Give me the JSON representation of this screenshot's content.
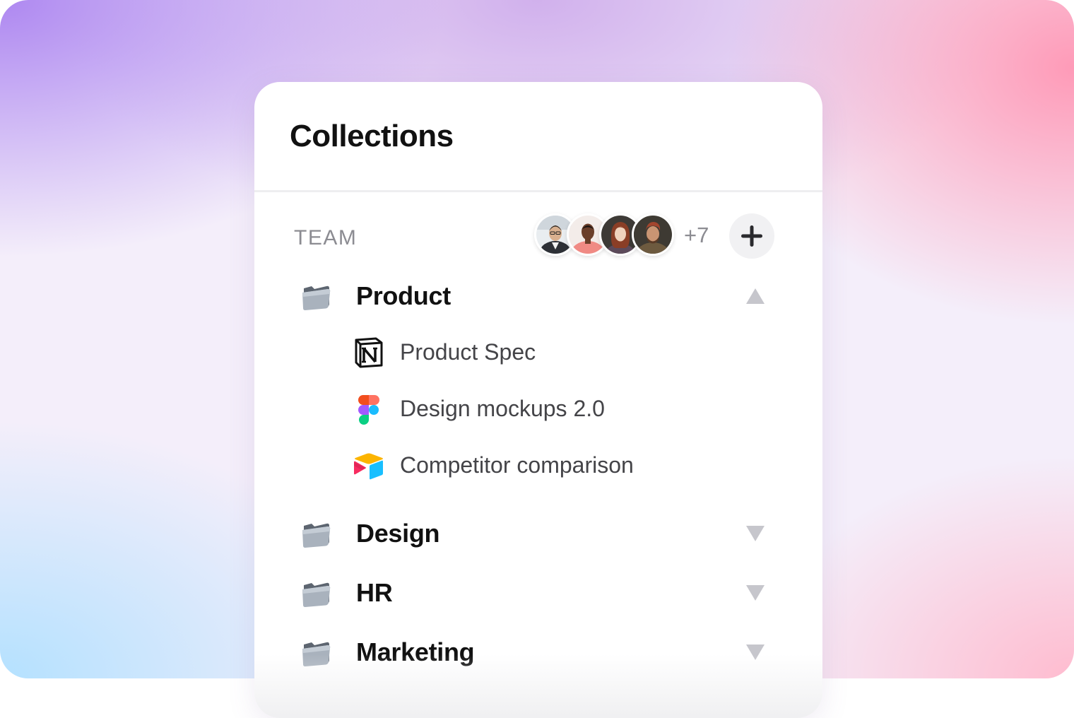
{
  "panel": {
    "title": "Collections"
  },
  "team": {
    "label": "TEAM",
    "more_count": "+7",
    "avatars": [
      "member-1",
      "member-2",
      "member-3",
      "member-4"
    ],
    "add_icon": "plus-icon"
  },
  "folders": [
    {
      "name": "Product",
      "icon": "folder-icon",
      "expanded": true,
      "items": [
        {
          "label": "Product Spec",
          "icon": "notion-icon"
        },
        {
          "label": "Design mockups 2.0",
          "icon": "figma-icon"
        },
        {
          "label": "Competitor comparison",
          "icon": "airtable-icon"
        }
      ]
    },
    {
      "name": "Design",
      "icon": "folder-icon",
      "expanded": false
    },
    {
      "name": "HR",
      "icon": "folder-icon",
      "expanded": false
    },
    {
      "name": "Marketing",
      "icon": "folder-icon",
      "expanded": false
    }
  ],
  "colors": {
    "title_text": "#111111",
    "muted_text": "#8c8c92",
    "item_text": "#444448",
    "chevron": "#c6c6cc",
    "card_bg": "#ffffff"
  }
}
